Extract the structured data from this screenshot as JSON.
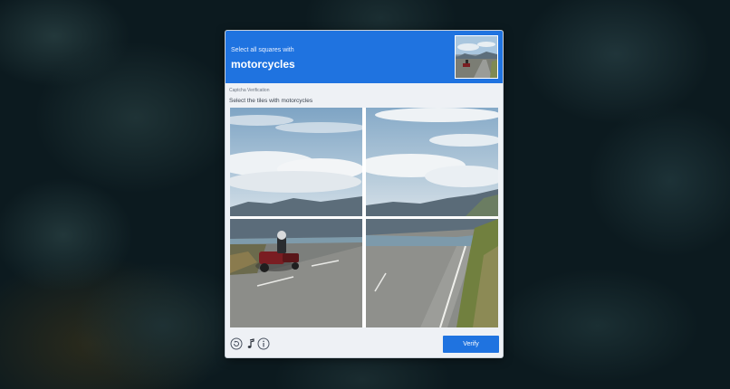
{
  "captcha": {
    "header": {
      "instruction_prefix": "Select all squares with",
      "target_object": "motorcycles"
    },
    "subtitle": "Captcha Verification",
    "prompt": "Select the tiles with motorcycles",
    "grid": {
      "rows": 2,
      "columns": 2,
      "tiles": [
        {
          "id": "tile-1",
          "content": "sky"
        },
        {
          "id": "tile-2",
          "content": "sky"
        },
        {
          "id": "tile-3",
          "content": "motorcycle-on-road"
        },
        {
          "id": "tile-4",
          "content": "road"
        }
      ]
    },
    "footer": {
      "icons": [
        "refresh-icon",
        "audio-icon",
        "info-icon"
      ],
      "verify_label": "Verify"
    }
  },
  "colors": {
    "accent": "#1f73e0",
    "dialog_background": "#eef1f5",
    "page_background": "#0c1a1f"
  }
}
